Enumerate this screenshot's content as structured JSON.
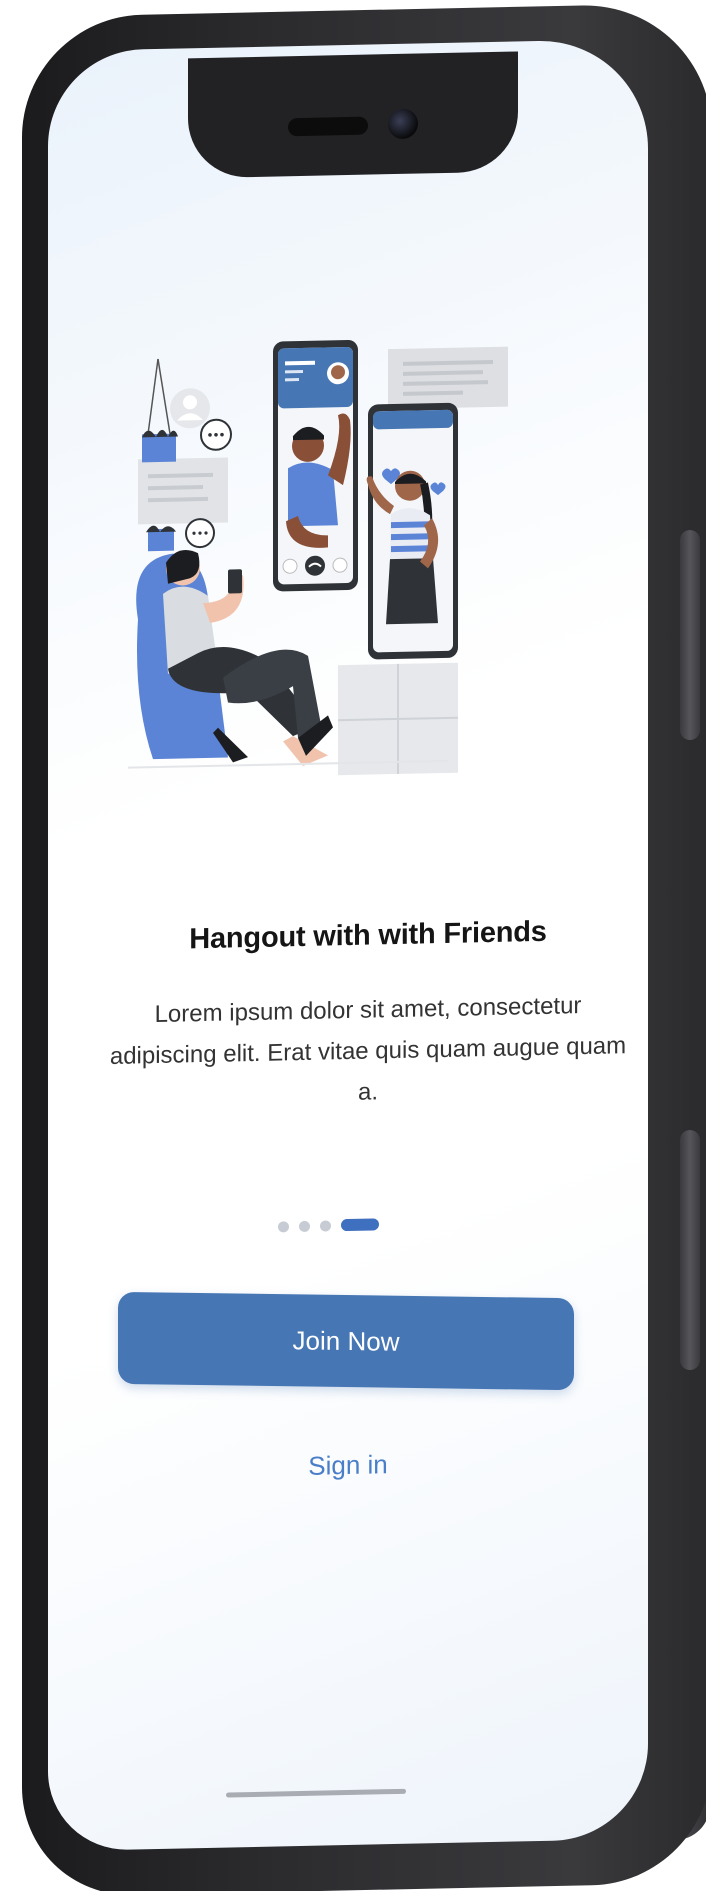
{
  "screen": {
    "title": "Hangout with with Friends",
    "description": "Lorem ipsum dolor sit amet, consectetur adipiscing elit. Erat vitae quis quam augue quam a.",
    "join_label": "Join Now",
    "signin_label": "Sign in"
  },
  "pager": {
    "total": 4,
    "active_index": 3
  },
  "colors": {
    "primary": "#4676b4",
    "link": "#4a7ec8",
    "illustration_blue": "#5b84d6",
    "illustration_dark": "#2f3337"
  },
  "icons": {
    "illustration": "video-call-illustration",
    "end-call": "phone-hangup-icon",
    "avatar": "user-avatar-icon",
    "chat": "chat-bubble-icon",
    "heart": "heart-icon"
  }
}
